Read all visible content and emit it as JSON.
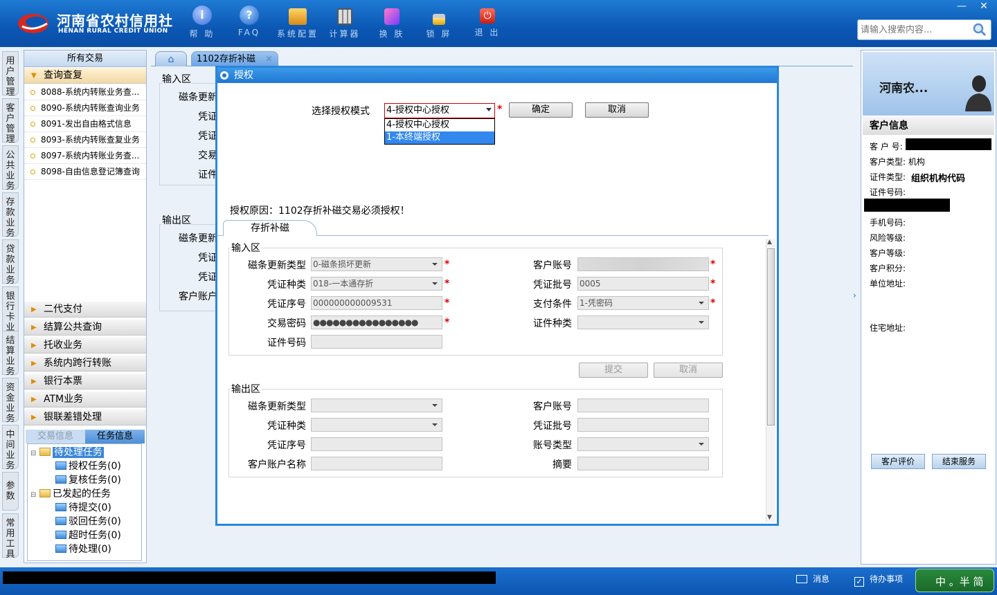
{
  "header": {
    "logo_cn": "河南省农村信用社",
    "logo_en": "HENAN RURAL CREDIT UNION",
    "toolbar": [
      {
        "label": "帮 助",
        "icon": "help-icon"
      },
      {
        "label": "FAQ",
        "icon": "faq-icon"
      },
      {
        "label": "系统配置",
        "icon": "system-config-icon"
      },
      {
        "label": "计算器",
        "icon": "calculator-icon"
      },
      {
        "label": "换 肤",
        "icon": "skin-icon"
      },
      {
        "label": "锁 屏",
        "icon": "lock-icon"
      },
      {
        "label": "退 出",
        "icon": "exit-icon"
      }
    ],
    "search_placeholder": "请输入搜索内容..."
  },
  "side_tabs": [
    "用户管理",
    "客户管理",
    "公共业务",
    "存款业务",
    "贷款业务",
    "银行卡业务",
    "结算业务",
    "资金业务",
    "中间业务",
    "参数",
    "常用工具"
  ],
  "left_nav": {
    "header": "所有交易",
    "open_section": "查询查复",
    "items": [
      "8088-系统内转账业务查...",
      "8090-系统内转账查询业务",
      "8091-发出自由格式信息",
      "8093-系统内转账查复业务",
      "8097-系统内转账业务查...",
      "8098-自由信息登记簿查询"
    ],
    "sections": [
      "二代支付",
      "结算公共查询",
      "托收业务",
      "系统内跨行转账",
      "银行本票",
      "ATM业务",
      "银联差错处理"
    ],
    "subtabs": [
      "交易信息",
      "任务信息"
    ],
    "tree": {
      "pending": "待处理任务",
      "pending_children": [
        "授权任务(0)",
        "复核任务(0)"
      ],
      "initiated": "已发起的任务",
      "initiated_children": [
        "待提交(0)",
        "驳回任务(0)",
        "超时任务(0)",
        "待处理(0)"
      ]
    }
  },
  "main_tabs": {
    "active": "1102存折补磁",
    "close": "×"
  },
  "background_form": {
    "input_area": "输入区",
    "output_area": "输出区",
    "labels_in": [
      "磁条更新",
      "凭证",
      "凭证",
      "交易",
      "证件"
    ],
    "labels_out": [
      "磁条更新",
      "凭证",
      "凭证",
      "客户账户"
    ]
  },
  "dialog": {
    "title": "授权",
    "mode_label": "选择授权模式",
    "mode_value": "4-授权中心授权",
    "mode_options": [
      "4-授权中心授权",
      "1-本终端授权"
    ],
    "confirm": "确定",
    "cancel": "取消",
    "reason": "授权原因：1102存折补磁交易必须授权！",
    "inner_tab": "存折补磁",
    "input_area": {
      "legend": "输入区",
      "fields": {
        "mag_type_label": "磁条更新类型",
        "mag_type_value": "0-磁条损坏更新",
        "account_label": "客户账号",
        "voucher_type_label": "凭证种类",
        "voucher_type_value": "018-一本通存折",
        "voucher_batch_label": "凭证批号",
        "voucher_batch_value": "0005",
        "voucher_seq_label": "凭证序号",
        "voucher_seq_value": "000000000009531",
        "pay_cond_label": "支付条件",
        "pay_cond_value": "1-凭密码",
        "password_label": "交易密码",
        "password_value": "●●●●●●●●●●●●●●●●",
        "id_type_label": "证件种类",
        "id_no_label": "证件号码"
      }
    },
    "submit": "提交",
    "cancel2": "取消",
    "output_area": {
      "legend": "输出区",
      "labels": {
        "mag_type": "磁条更新类型",
        "account": "客户账号",
        "voucher_type": "凭证种类",
        "voucher_batch": "凭证批号",
        "voucher_seq": "凭证序号",
        "account_type": "账号类型",
        "account_name": "客户账户名称",
        "summary": "摘要"
      }
    }
  },
  "right_panel": {
    "customer_name": "河南农...",
    "section_title": "客户信息",
    "customer_no_label": "客 户 号:",
    "customer_type": "客户类型: 机构",
    "id_type_label": "证件类型:",
    "id_type_value": "组织机构代码",
    "id_no_label": "证件号码:",
    "phone": "手机号码:",
    "risk": "风险等级:",
    "level": "客户等级:",
    "points": "客户积分:",
    "company_addr": "单位地址:",
    "home_addr": "住宅地址:",
    "evaluate": "客户评价",
    "end_service": "结束服务"
  },
  "status_bar": {
    "message": "消息",
    "todo": "待办事项",
    "ime": "中 。半 简"
  }
}
